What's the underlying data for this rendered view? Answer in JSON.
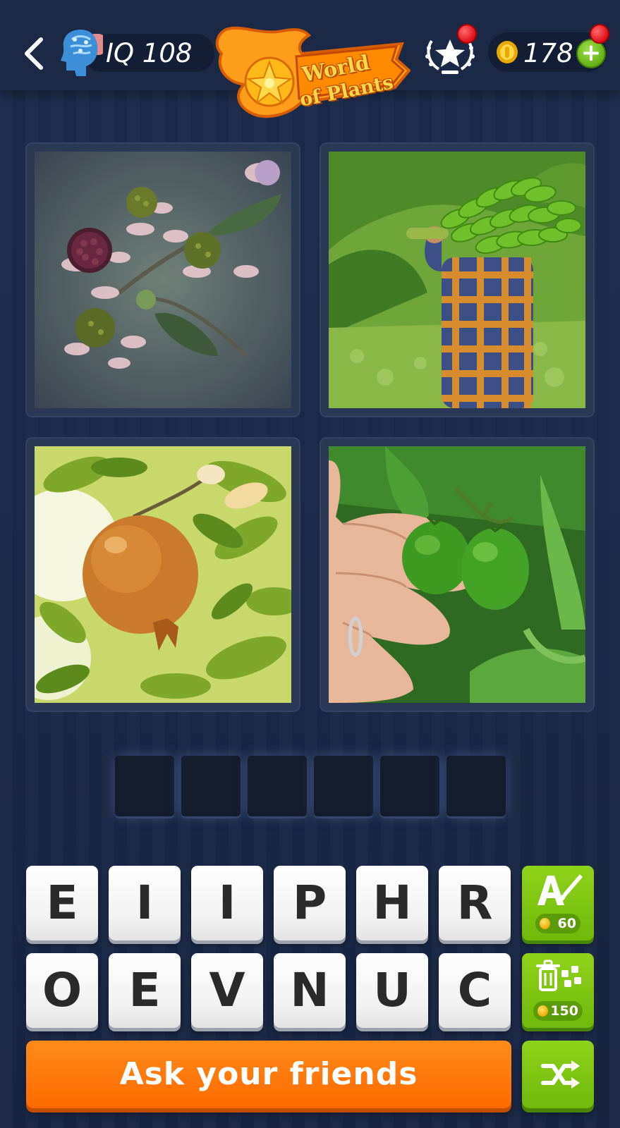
{
  "header": {
    "iq_label": "IQ 108",
    "logo_line1": "World",
    "logo_line2": "of Plants",
    "coins": "178",
    "add_coins_label": "+"
  },
  "pictures": [
    {
      "icon": "blackberry-blossom-photo"
    },
    {
      "icon": "banana-bunch-carrier-photo"
    },
    {
      "icon": "pomegranate-on-branch-photo"
    },
    {
      "icon": "green-tomatoes-in-hand-photo"
    }
  ],
  "answer": {
    "slots": [
      "",
      "",
      "",
      "",
      "",
      ""
    ]
  },
  "letters": {
    "row1": [
      "E",
      "I",
      "I",
      "P",
      "H",
      "R"
    ],
    "row2": [
      "O",
      "E",
      "V",
      "N",
      "U",
      "C"
    ]
  },
  "hints": {
    "reveal_letter_cost": "60",
    "remove_letters_cost": "150"
  },
  "footer": {
    "ask_friends_label": "Ask your friends"
  },
  "colors": {
    "background": "#1b2947",
    "accent_orange": "#ff7a00",
    "accent_green": "#7cc410",
    "notification": "#e0101a"
  }
}
